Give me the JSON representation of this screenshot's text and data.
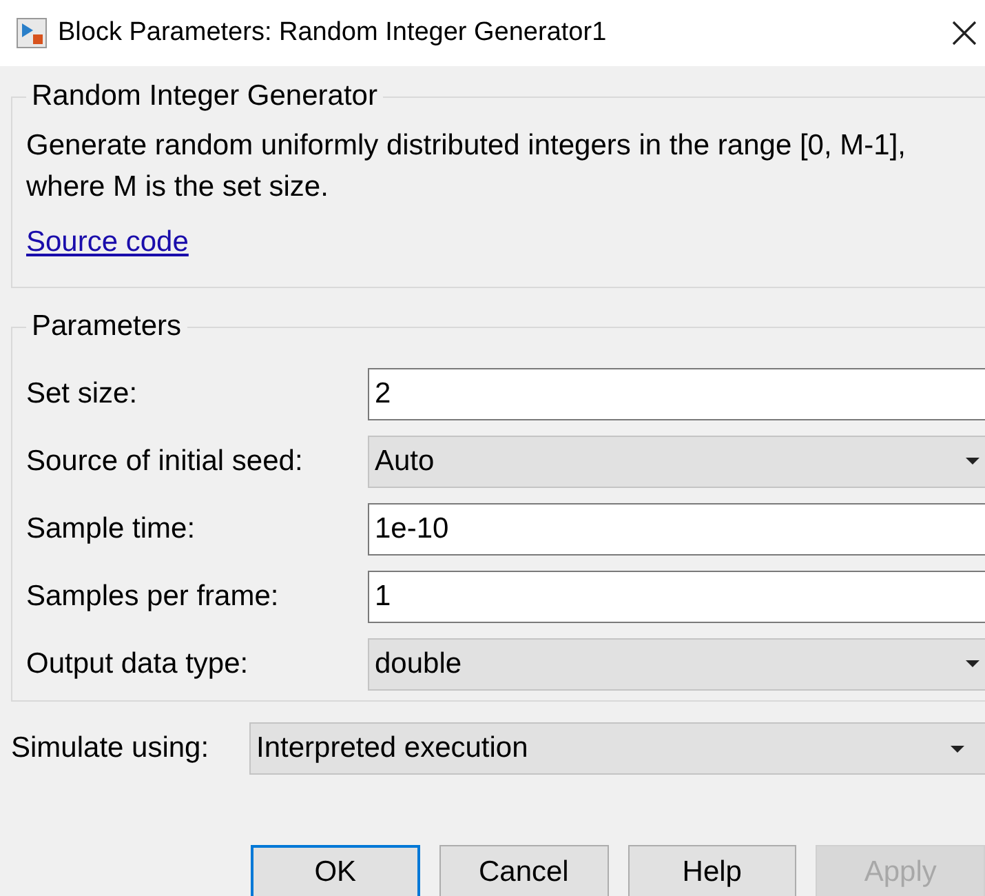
{
  "window": {
    "title": "Block Parameters: Random Integer Generator1"
  },
  "description_group": {
    "title": "Random Integer Generator",
    "description": "Generate random uniformly distributed integers in the range [0, M-1], where M is the set size.",
    "link": "Source code"
  },
  "parameters": {
    "title": "Parameters",
    "fields": [
      {
        "label": "Set size:",
        "kind": "text",
        "value": "2"
      },
      {
        "label": "Source of initial seed:",
        "kind": "dropdown",
        "value": "Auto"
      },
      {
        "label": "Sample time:",
        "kind": "text",
        "value": "1e-10"
      },
      {
        "label": "Samples per frame:",
        "kind": "text",
        "value": "1"
      },
      {
        "label": "Output data type:",
        "kind": "dropdown",
        "value": "double"
      }
    ]
  },
  "simulate": {
    "label": "Simulate using:",
    "kind": "dropdown",
    "value": "Interpreted execution"
  },
  "buttons": [
    {
      "label": "OK",
      "focused": true,
      "disabled": false
    },
    {
      "label": "Cancel",
      "focused": false,
      "disabled": false
    },
    {
      "label": "Help",
      "focused": false,
      "disabled": false
    },
    {
      "label": "Apply",
      "focused": false,
      "disabled": true
    }
  ]
}
